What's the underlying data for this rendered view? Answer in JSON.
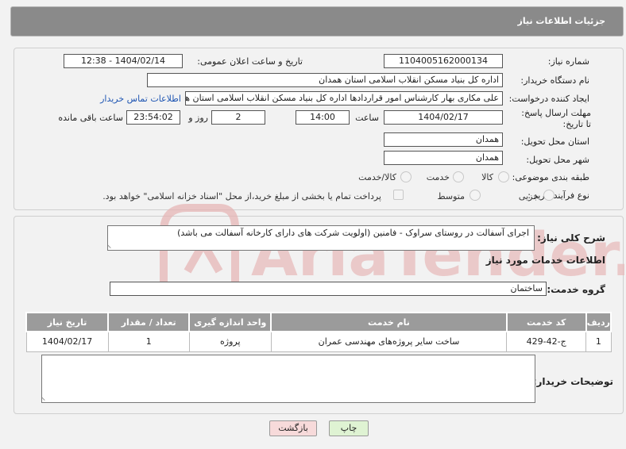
{
  "header": {
    "title": "جزئیات اطلاعات نیاز"
  },
  "fields": {
    "need_number_label": "شماره نیاز:",
    "need_number": "1104005162000134",
    "announce_label": "تاریخ و ساعت اعلان عمومی:",
    "announce_value": "1404/02/14 - 12:38",
    "buyer_org_label": "نام دستگاه خریدار:",
    "buyer_org": "اداره کل بنیاد مسکن انقلاب اسلامی استان همدان",
    "requester_label": "ایجاد کننده درخواست:",
    "requester": "علی مکاری بهار کارشناس امور قراردادها اداره کل بنیاد مسکن انقلاب اسلامی استان همدان",
    "contact_link": "اطلاعات تماس خریدار",
    "deadline_label": "مهلت ارسال پاسخ: تا تاریخ:",
    "deadline_date": "1404/02/17",
    "time_label": "ساعت",
    "deadline_time": "14:00",
    "days_value": "2",
    "days_label": "روز و",
    "remaining_time": "23:54:02",
    "remaining_label": "ساعت باقی مانده",
    "province_label": "استان محل تحویل:",
    "province": "همدان",
    "city_label": "شهر محل تحویل:",
    "city": "همدان",
    "category_label": "طبقه بندی موضوعی:",
    "category_options": [
      "کالا",
      "خدمت",
      "کالا/خدمت"
    ],
    "purchase_type_label": "نوع فرآیند خرید :",
    "purchase_type_options": [
      "جزیی",
      "متوسط"
    ],
    "payment_note": "پرداخت تمام یا بخشی از مبلغ خرید،از محل \"اسناد خزانه اسلامی\" خواهد بود."
  },
  "summary": {
    "label": "شرح کلی نیاز:",
    "text": "اجرای آسفالت در روستای سراوک - فامنین (اولویت شرکت های دارای کارخانه آسفالت می باشد)"
  },
  "services": {
    "section_title": "اطلاعات خدمات مورد نیاز",
    "group_label": "گروه خدمت:",
    "group_value": "ساختمان",
    "columns": [
      "ردیف",
      "کد خدمت",
      "نام خدمت",
      "واحد اندازه گیری",
      "تعداد / مقدار",
      "تاریخ نیاز"
    ],
    "rows": [
      {
        "row": "1",
        "code": "ج-42-429",
        "name": "ساخت سایر پروژه‌های مهندسی عمران",
        "unit": "پروژه",
        "qty": "1",
        "date": "1404/02/17"
      }
    ]
  },
  "buyer_notes": {
    "label": "توضیحات خریدار:",
    "value": ""
  },
  "buttons": {
    "print": "چاپ",
    "back": "بازگشت"
  },
  "watermark": {
    "text": "AriaTender.net",
    "color": "#e3a3a3"
  },
  "colors": {
    "header_bg": "#8a8a8a",
    "link": "#1f56b3",
    "print_btn": "#dff3d3",
    "back_btn": "#f7dada"
  }
}
